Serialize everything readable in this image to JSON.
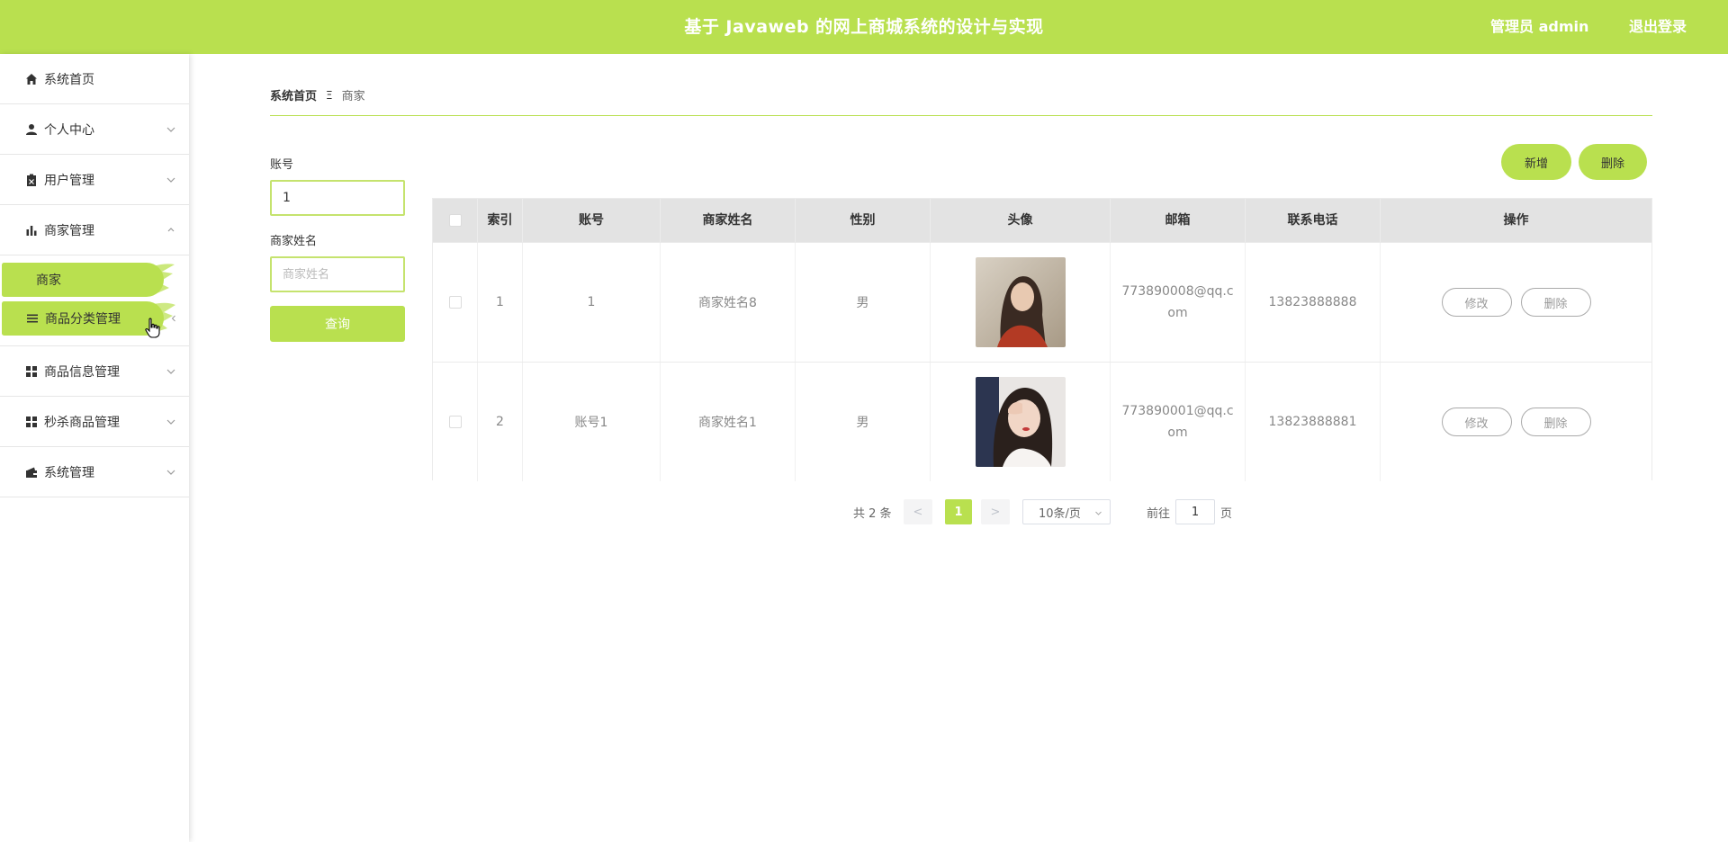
{
  "header": {
    "title": "基于 Javaweb 的网上商城系统的设计与实现",
    "admin": "管理员 admin",
    "logout": "退出登录"
  },
  "colors": {
    "accent": "#b9e04f"
  },
  "sidebar": {
    "items": [
      {
        "label": "系统首页",
        "icon": "home-icon"
      },
      {
        "label": "个人中心",
        "icon": "user-icon"
      },
      {
        "label": "用户管理",
        "icon": "clipboard-icon"
      },
      {
        "label": "商家管理",
        "icon": "bar-chart-icon"
      },
      {
        "label": "商品分类管理",
        "icon": "list-icon"
      },
      {
        "label": "商品信息管理",
        "icon": "grid-icon"
      },
      {
        "label": "秒杀商品管理",
        "icon": "grid-icon"
      },
      {
        "label": "系统管理",
        "icon": "wallet-icon"
      }
    ],
    "sub_items": [
      {
        "label": "商家"
      }
    ]
  },
  "breadcrumb": {
    "home": "系统首页",
    "separator": "Ξ",
    "current": "商家"
  },
  "search": {
    "account_label": "账号",
    "account_value": "1",
    "name_label": "商家姓名",
    "name_placeholder": "商家姓名",
    "query_button": "查询"
  },
  "actions": {
    "add": "新增",
    "delete": "删除"
  },
  "table": {
    "columns": [
      "索引",
      "账号",
      "商家姓名",
      "性别",
      "头像",
      "邮箱",
      "联系电话",
      "操作"
    ],
    "rows": [
      {
        "index": "1",
        "account": "1",
        "name": "商家姓名8",
        "gender": "男",
        "email": "773890008@qq.com",
        "phone": "13823888888",
        "edit": "修改",
        "delete": "删除"
      },
      {
        "index": "2",
        "account": "账号1",
        "name": "商家姓名1",
        "gender": "男",
        "email": "773890001@qq.com",
        "phone": "13823888881",
        "edit": "修改",
        "delete": "删除"
      }
    ]
  },
  "pagination": {
    "total": "共 2 条",
    "prev": "<",
    "current_page": "1",
    "next": ">",
    "page_size": "10条/页",
    "goto_label": "前往",
    "goto_value": "1",
    "goto_suffix": "页"
  }
}
